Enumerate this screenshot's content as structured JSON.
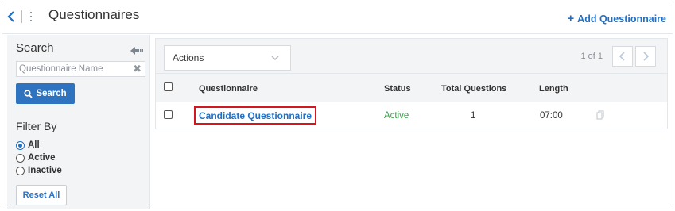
{
  "header": {
    "title": "Questionnaires",
    "add_button": "Add Questionnaire"
  },
  "sidebar": {
    "search_title": "Search",
    "search_placeholder": "Questionnaire Name",
    "search_button": "Search",
    "filter_title": "Filter By",
    "filters": [
      {
        "label": "All",
        "checked": true
      },
      {
        "label": "Active",
        "checked": false
      },
      {
        "label": "Inactive",
        "checked": false
      }
    ],
    "reset_button": "Reset All"
  },
  "toolbar": {
    "actions_label": "Actions",
    "pager_text": "1 of 1"
  },
  "table": {
    "columns": [
      "Questionnaire",
      "Status",
      "Total Questions",
      "Length"
    ],
    "rows": [
      {
        "questionnaire": "Candidate Questionnaire",
        "status": "Active",
        "total_questions": "1",
        "length": "07:00"
      }
    ]
  },
  "colors": {
    "accent": "#1f6fc5",
    "status_active": "#3aa24a",
    "highlight_box": "#d4171e"
  },
  "icons": [
    "back-chevron-icon",
    "kebab-menu-icon",
    "plus-icon",
    "collapse-arrow-icon",
    "clear-x-icon",
    "search-icon",
    "chevron-down-icon",
    "pager-prev-icon",
    "pager-next-icon",
    "copy-icon"
  ]
}
